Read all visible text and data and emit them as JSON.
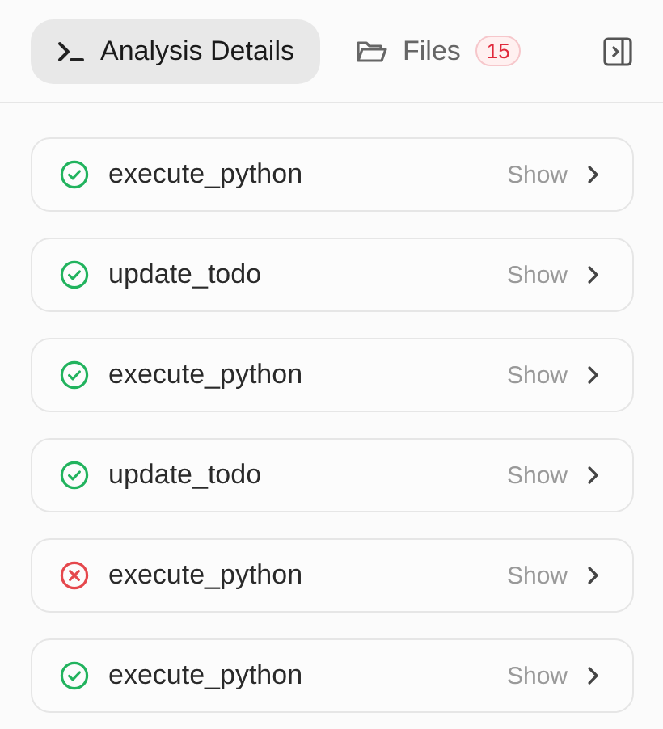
{
  "tabs": [
    {
      "label": "Analysis Details",
      "kind": "terminal",
      "selected": true
    },
    {
      "label": "Files",
      "kind": "folder",
      "selected": false,
      "badge": "15"
    }
  ],
  "steps": [
    {
      "name": "execute_python",
      "kind": "success",
      "action": "Show"
    },
    {
      "name": "update_todo",
      "kind": "success",
      "action": "Show"
    },
    {
      "name": "execute_python",
      "kind": "success",
      "action": "Show"
    },
    {
      "name": "update_todo",
      "kind": "success",
      "action": "Show"
    },
    {
      "name": "execute_python",
      "kind": "error",
      "action": "Show"
    },
    {
      "name": "execute_python",
      "kind": "success",
      "action": "Show"
    }
  ]
}
